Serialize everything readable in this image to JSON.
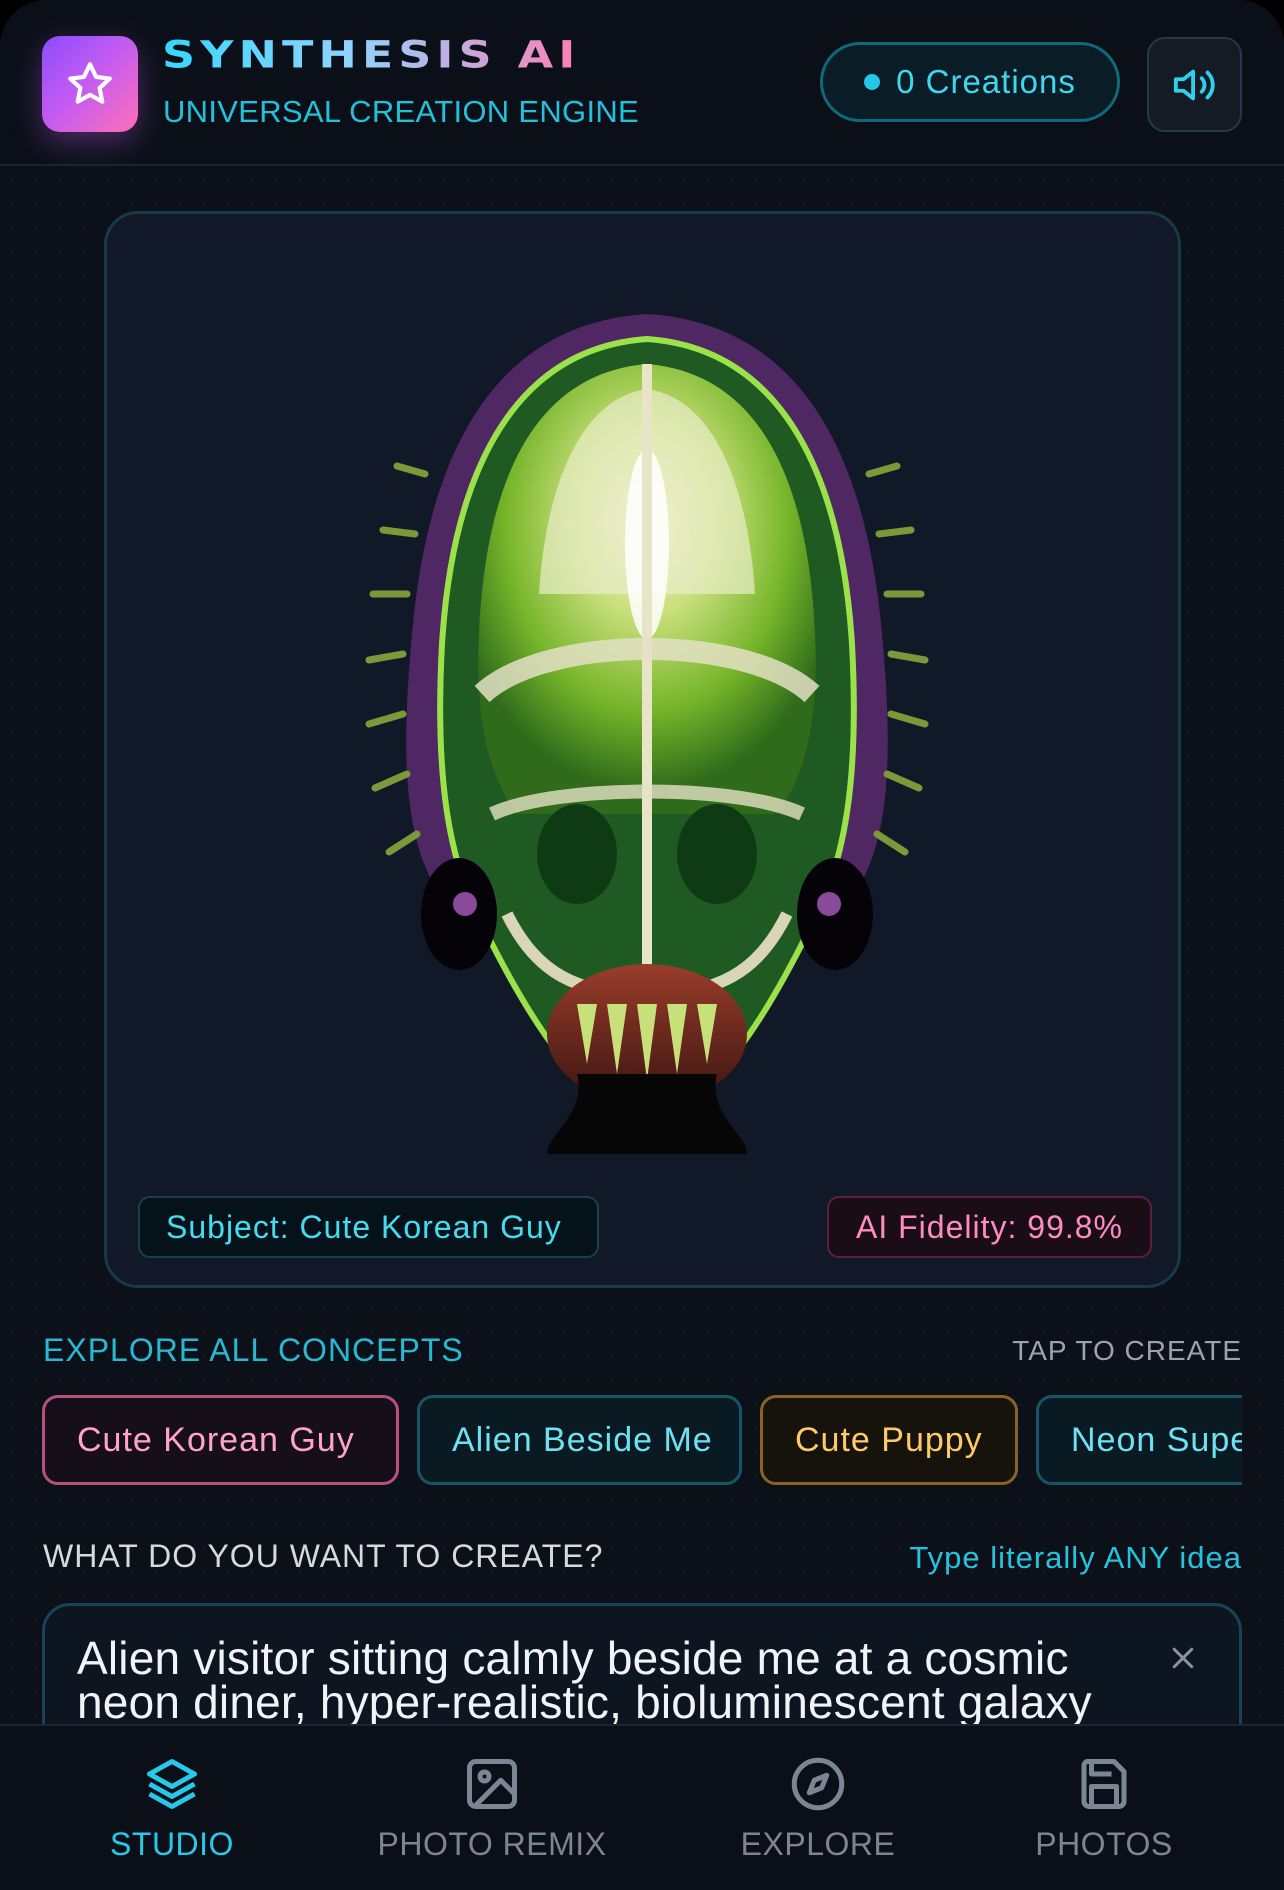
{
  "header": {
    "app_title": "SYNTHESIS AI",
    "app_subtitle": "UNIVERSAL CREATION ENGINE",
    "logo_icon": "star-icon",
    "creations_label": "0 Creations",
    "sound_icon": "volume-icon"
  },
  "preview": {
    "subject_chip": "Subject: Cute Korean Guy",
    "fidelity_chip": "AI Fidelity: 99.8%"
  },
  "concepts": {
    "heading": "EXPLORE ALL CONCEPTS",
    "hint": "TAP TO CREATE",
    "items": [
      {
        "label": "Cute Korean Guy",
        "color": "#ffa3cd"
      },
      {
        "label": "Alien Beside Me",
        "color": "#6fe1f3"
      },
      {
        "label": "Cute Puppy",
        "color": "#ffc96a"
      },
      {
        "label": "Neon Supe",
        "color": "#6fe1f3"
      }
    ]
  },
  "prompt": {
    "heading": "WHAT DO YOU WANT TO CREATE?",
    "hint": "Type literally ANY idea",
    "value": "Alien visitor sitting calmly beside me at a cosmic neon diner, hyper-realistic, bioluminescent galaxy",
    "clear_icon": "close-icon"
  },
  "nav": {
    "items": [
      {
        "label": "STUDIO",
        "icon": "layers-icon",
        "active": true
      },
      {
        "label": "PHOTO REMIX",
        "icon": "image-icon",
        "active": false
      },
      {
        "label": "EXPLORE",
        "icon": "compass-icon",
        "active": false
      },
      {
        "label": "PHOTOS",
        "icon": "save-icon",
        "active": false
      }
    ]
  },
  "colors": {
    "accent_cyan": "#27c9ea",
    "accent_pink": "#ff8cc0",
    "background": "#0c1119"
  }
}
